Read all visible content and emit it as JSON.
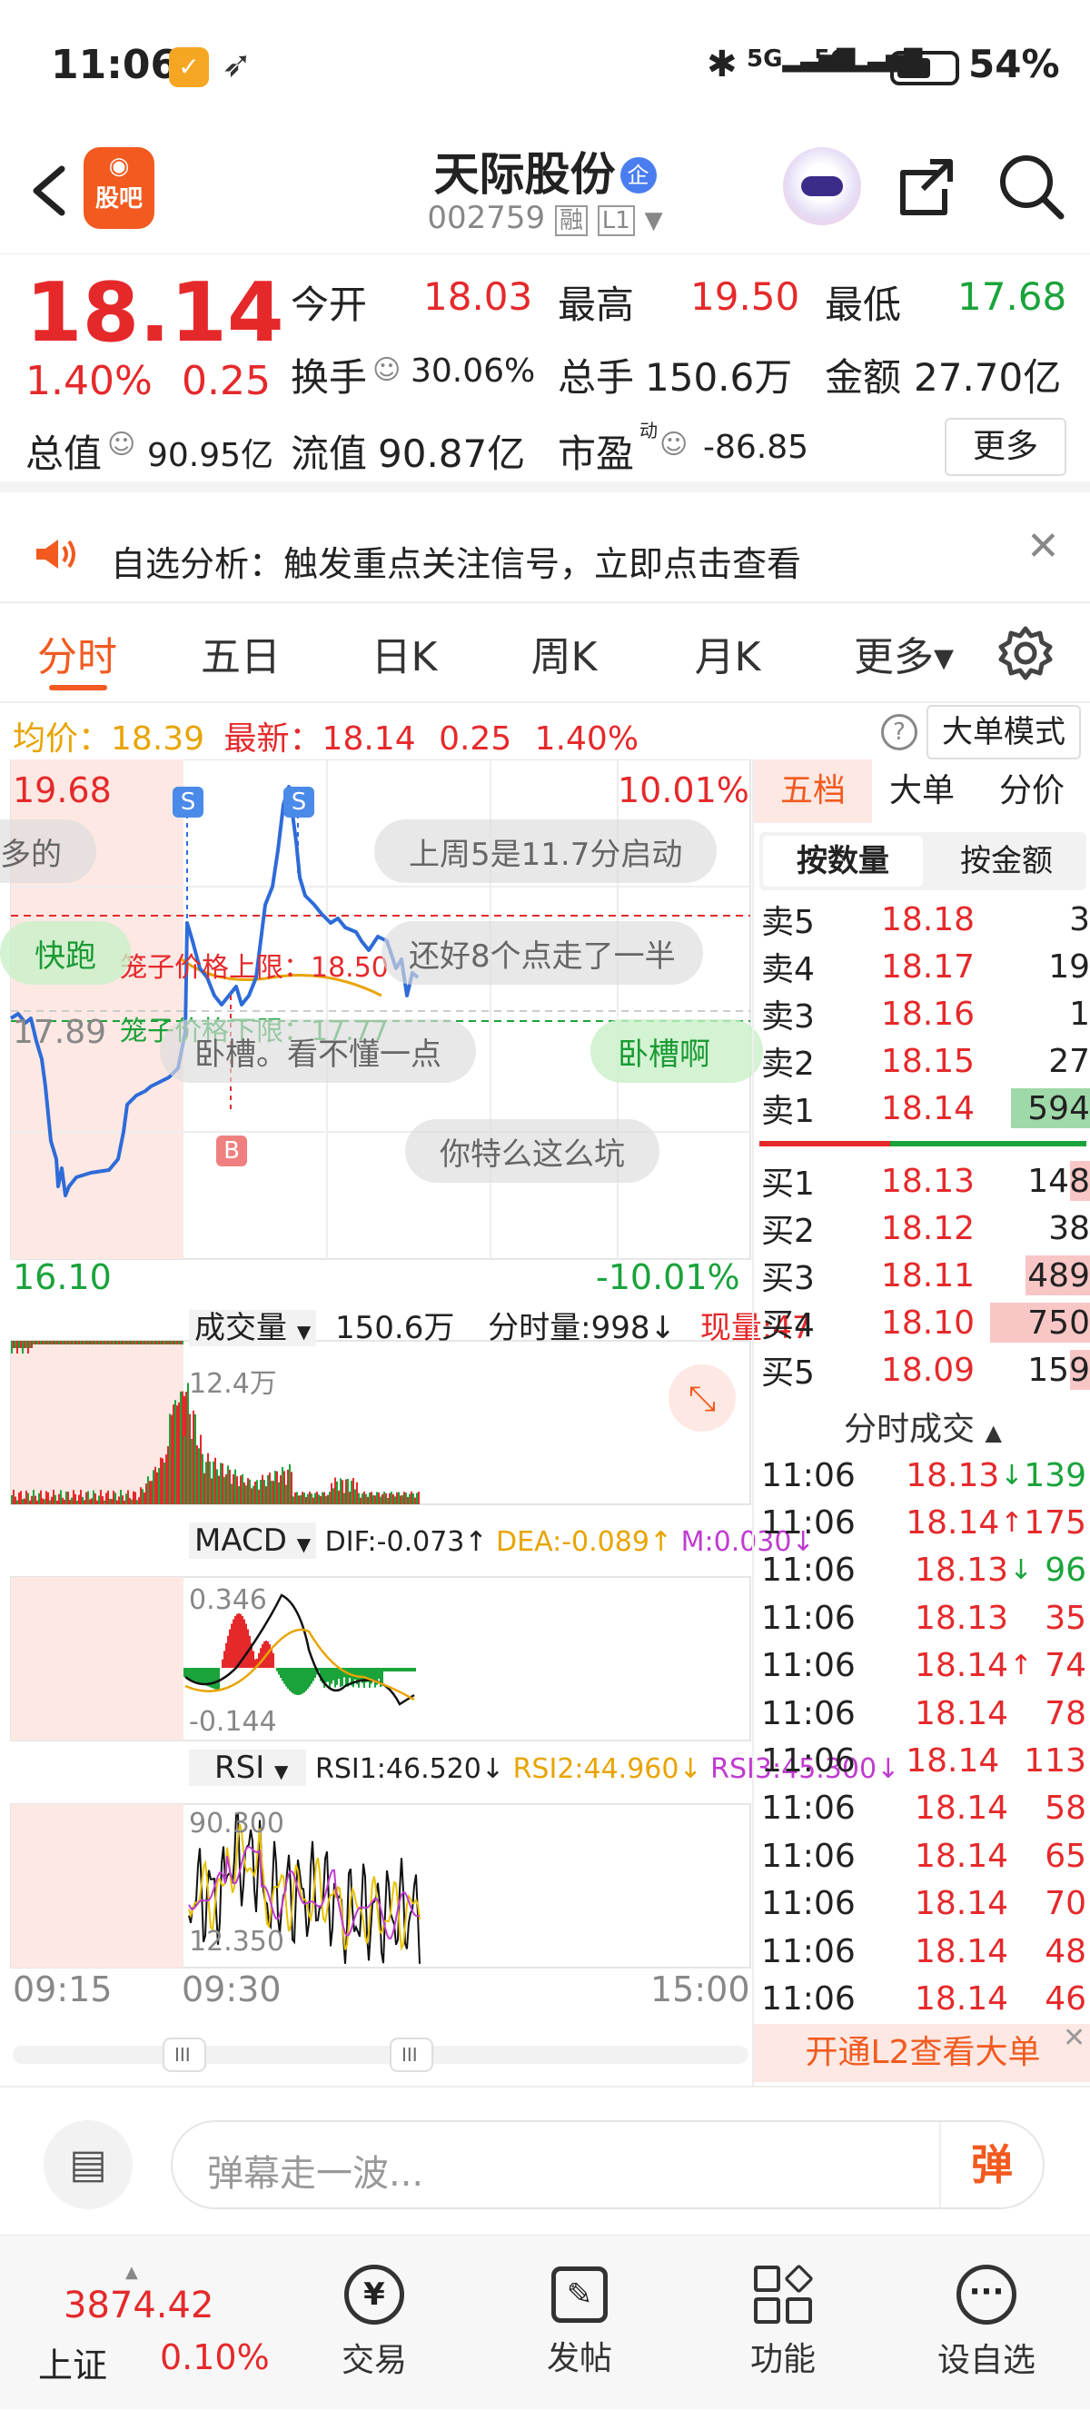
{
  "status": {
    "time": "11:06",
    "battery": "54%",
    "net1": "5G",
    "net2": "5G"
  },
  "header": {
    "back_label": "",
    "tag": "股吧",
    "title": "天际股份",
    "title_badge": "企",
    "code": "002759",
    "margin_tag": "融",
    "level_tag": "L1"
  },
  "quote": {
    "price": "18.14",
    "pct": "1.40%",
    "chg": "0.25",
    "open_label": "今开",
    "open": "18.03",
    "high_label": "最高",
    "high": "19.50",
    "low_label": "最低",
    "low": "17.68",
    "turnover_label": "换手",
    "turnover": "30.06%",
    "vol_label": "总手",
    "vol": "150.6万",
    "amt_label": "金额",
    "amt": "27.70亿",
    "mcap_label": "总值",
    "mcap": "90.95亿",
    "fcap_label": "流值",
    "fcap": "90.87亿",
    "pe_label": "市盈",
    "pe_sup": "动",
    "pe": "-86.85",
    "more_button": "更多"
  },
  "notice": {
    "text": "自选分析：触发重点关注信号，立即点击查看"
  },
  "tabs": {
    "items": [
      "分时",
      "五日",
      "日K",
      "周K",
      "月K",
      "更多▾"
    ],
    "active": 0
  },
  "chart": {
    "avg_label": "均价：",
    "avg": "18.39",
    "latest_label": "最新：",
    "latest": "18.14",
    "chg": "0.25",
    "pct": "1.40%",
    "big_order_mode": "大单模式",
    "ymax": "19.68",
    "ymid": "17.89",
    "ymin": "16.10",
    "pmax": "10.01%",
    "pmin": "-10.01%",
    "cage_upper": "笼子价格上限：18.50",
    "cage_lower": "笼子价格下限：17.77",
    "signal_s": "S",
    "signal_b": "B",
    "vol_label": "成交量",
    "vol_total": "150.6万",
    "vol_tick": "分时量:998↓",
    "vol_now": "现量:47",
    "vol_max": "12.4万",
    "macd_label": "MACD",
    "dif": "DIF:-0.073↑",
    "dea": "DEA:-0.089↑",
    "m": "M:0.030↓",
    "macd_max": "0.346",
    "macd_min": "-0.144",
    "rsi_label": "RSI",
    "rsi1": "RSI1:46.520↓",
    "rsi2": "RSI2:44.960↓",
    "rsi3": "RSI3:45.300↓",
    "rsi_max": "90.300",
    "rsi_min": "12.350",
    "t_start": "09:15",
    "t_open": "09:30",
    "t_end": "15:00"
  },
  "danmaku": [
    "多的",
    "上周5是11.7分启动",
    "快跑",
    "还好8个点走了一半",
    "卧槽。看不懂一点",
    "卧槽啊",
    "你特么这么坑"
  ],
  "orderbook": {
    "tabs": [
      "五档",
      "大单",
      "分价"
    ],
    "subtabs": [
      "按数量",
      "按金额"
    ],
    "asks": [
      {
        "l": "卖5",
        "p": "18.18",
        "q": "3",
        "w": 0
      },
      {
        "l": "卖4",
        "p": "18.17",
        "q": "19",
        "w": 0
      },
      {
        "l": "卖3",
        "p": "18.16",
        "q": "1",
        "w": 0
      },
      {
        "l": "卖2",
        "p": "18.15",
        "q": "27",
        "w": 0
      },
      {
        "l": "卖1",
        "p": "18.14",
        "q": "594",
        "w": 0.79
      }
    ],
    "bids": [
      {
        "l": "买1",
        "p": "18.13",
        "q": "148",
        "w": 0.2
      },
      {
        "l": "买2",
        "p": "18.12",
        "q": "38",
        "w": 0
      },
      {
        "l": "买3",
        "p": "18.11",
        "q": "489",
        "w": 0.65
      },
      {
        "l": "买4",
        "p": "18.10",
        "q": "750",
        "w": 1
      },
      {
        "l": "买5",
        "p": "18.09",
        "q": "159",
        "w": 0.2
      }
    ],
    "trades_title": "分时成交",
    "trades": [
      {
        "t": "11:06",
        "p": "18.13",
        "a": "↓",
        "v": "139"
      },
      {
        "t": "11:06",
        "p": "18.14",
        "a": "↑",
        "v": "175"
      },
      {
        "t": "11:06",
        "p": "18.13",
        "a": "↓",
        "v": "96"
      },
      {
        "t": "11:06",
        "p": "18.13",
        "a": "",
        "v": "35"
      },
      {
        "t": "11:06",
        "p": "18.14",
        "a": "↑",
        "v": "74"
      },
      {
        "t": "11:06",
        "p": "18.14",
        "a": "",
        "v": "78"
      },
      {
        "t": "11:06",
        "p": "18.14",
        "a": "",
        "v": "113"
      },
      {
        "t": "11:06",
        "p": "18.14",
        "a": "",
        "v": "58"
      },
      {
        "t": "11:06",
        "p": "18.14",
        "a": "",
        "v": "65"
      },
      {
        "t": "11:06",
        "p": "18.14",
        "a": "",
        "v": "70"
      },
      {
        "t": "11:06",
        "p": "18.14",
        "a": "",
        "v": "48"
      },
      {
        "t": "11:06",
        "p": "18.14",
        "a": "",
        "v": "46"
      }
    ],
    "l2_promo": "开通L2查看大单"
  },
  "comment": {
    "placeholder": "弹幕走一波...",
    "send": "弹"
  },
  "nav": {
    "index_value": "3874.42",
    "index_name": "上证",
    "index_pct": "0.10%",
    "items": [
      "交易",
      "发帖",
      "功能",
      "设自选"
    ]
  },
  "colors": {
    "up": "#e5292b",
    "down": "#1aa33b",
    "accent": "#f25a1f"
  }
}
